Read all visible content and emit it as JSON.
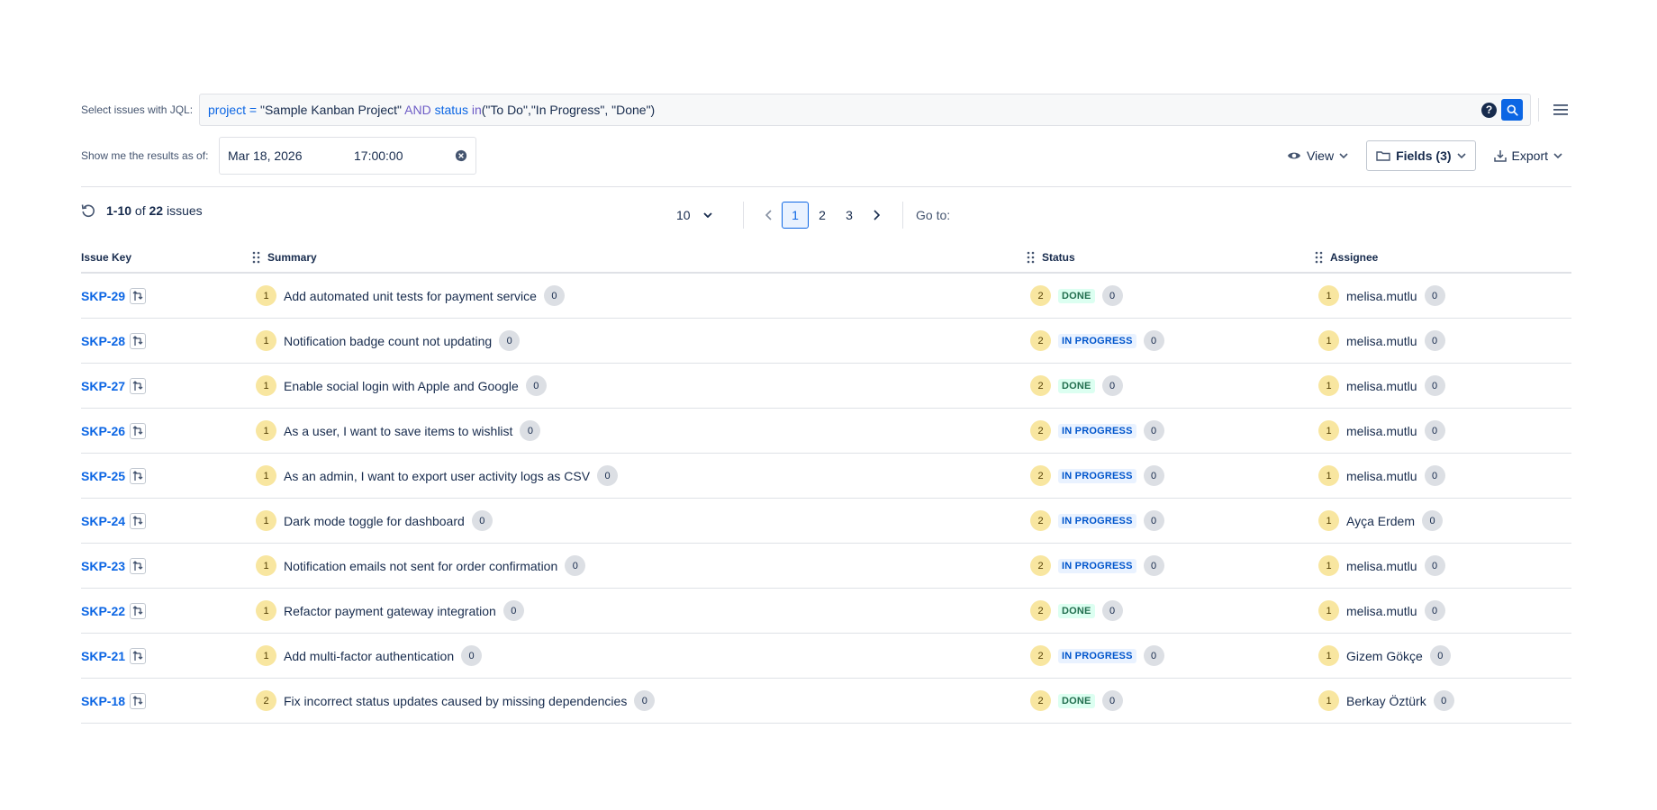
{
  "jql": {
    "label": "Select issues with JQL:",
    "tokens": {
      "field1": "project",
      "op1": "=",
      "val1": "\"Sample Kanban Project\"",
      "kw": "AND",
      "field2": "status",
      "op2": "in",
      "val2": "(\"To Do\",\"In Progress\", \"Done\")"
    }
  },
  "asof": {
    "label": "Show me the results as of:",
    "date": "Mar 18, 2026",
    "time": "17:00:00"
  },
  "toolbar": {
    "view_label": "View",
    "fields_label": "Fields (3)",
    "export_label": "Export"
  },
  "results": {
    "range": "1-10",
    "of_text": "of",
    "total": "22",
    "suffix": "issues"
  },
  "pagination": {
    "per_page": "10",
    "pages": [
      "1",
      "2",
      "3"
    ],
    "current": "1",
    "goto_label": "Go to:"
  },
  "table": {
    "headers": [
      "Issue Key",
      "Summary",
      "Status",
      "Assignee"
    ],
    "rows": [
      {
        "key": "SKP-29",
        "sum_badge": "1",
        "summary": "Add automated unit tests for payment service",
        "sum_count": "0",
        "status_badge": "2",
        "status": "DONE",
        "status_count": "0",
        "asg_badge": "1",
        "assignee": "melisa.mutlu",
        "asg_count": "0"
      },
      {
        "key": "SKP-28",
        "sum_badge": "1",
        "summary": "Notification badge count not updating",
        "sum_count": "0",
        "status_badge": "2",
        "status": "IN PROGRESS",
        "status_count": "0",
        "asg_badge": "1",
        "assignee": "melisa.mutlu",
        "asg_count": "0"
      },
      {
        "key": "SKP-27",
        "sum_badge": "1",
        "summary": "Enable social login with Apple and Google",
        "sum_count": "0",
        "status_badge": "2",
        "status": "DONE",
        "status_count": "0",
        "asg_badge": "1",
        "assignee": "melisa.mutlu",
        "asg_count": "0"
      },
      {
        "key": "SKP-26",
        "sum_badge": "1",
        "summary": "As a user, I want to save items to wishlist",
        "sum_count": "0",
        "status_badge": "2",
        "status": "IN PROGRESS",
        "status_count": "0",
        "asg_badge": "1",
        "assignee": "melisa.mutlu",
        "asg_count": "0"
      },
      {
        "key": "SKP-25",
        "sum_badge": "1",
        "summary": "As an admin, I want to export user activity logs as CSV",
        "sum_count": "0",
        "status_badge": "2",
        "status": "IN PROGRESS",
        "status_count": "0",
        "asg_badge": "1",
        "assignee": "melisa.mutlu",
        "asg_count": "0"
      },
      {
        "key": "SKP-24",
        "sum_badge": "1",
        "summary": "Dark mode toggle for dashboard",
        "sum_count": "0",
        "status_badge": "2",
        "status": "IN PROGRESS",
        "status_count": "0",
        "asg_badge": "1",
        "assignee": "Ayça Erdem",
        "asg_count": "0"
      },
      {
        "key": "SKP-23",
        "sum_badge": "1",
        "summary": "Notification emails not sent for order confirmation",
        "sum_count": "0",
        "status_badge": "2",
        "status": "IN PROGRESS",
        "status_count": "0",
        "asg_badge": "1",
        "assignee": "melisa.mutlu",
        "asg_count": "0"
      },
      {
        "key": "SKP-22",
        "sum_badge": "1",
        "summary": "Refactor payment gateway integration",
        "sum_count": "0",
        "status_badge": "2",
        "status": "DONE",
        "status_count": "0",
        "asg_badge": "1",
        "assignee": "melisa.mutlu",
        "asg_count": "0"
      },
      {
        "key": "SKP-21",
        "sum_badge": "1",
        "summary": "Add multi-factor authentication",
        "sum_count": "0",
        "status_badge": "2",
        "status": "IN PROGRESS",
        "status_count": "0",
        "asg_badge": "1",
        "assignee": "Gizem Gökçe",
        "asg_count": "0"
      },
      {
        "key": "SKP-18",
        "sum_badge": "2",
        "summary": "Fix incorrect status updates caused by missing dependencies",
        "sum_count": "0",
        "status_badge": "2",
        "status": "DONE",
        "status_count": "0",
        "asg_badge": "1",
        "assignee": "Berkay Öztürk",
        "asg_count": "0"
      }
    ]
  },
  "colors": {
    "accent": "#0c66e4",
    "done_bg": "#dcfff1",
    "done_fg": "#216e4e",
    "progress_bg": "#e9f2ff",
    "progress_fg": "#0055cc"
  }
}
